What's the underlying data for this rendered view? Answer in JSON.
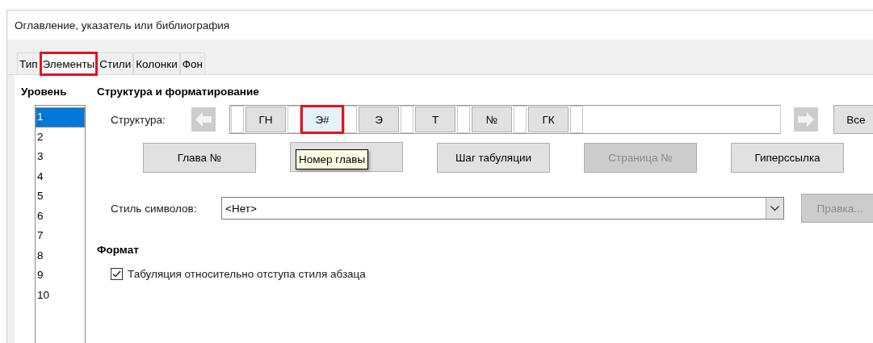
{
  "window": {
    "title": "Оглавление, указатель или библиография"
  },
  "tabs": [
    {
      "label": "Тип",
      "selected": false,
      "highlighted": false
    },
    {
      "label": "Элементы",
      "selected": true,
      "highlighted": true
    },
    {
      "label": "Стили",
      "selected": false,
      "highlighted": false
    },
    {
      "label": "Колонки",
      "selected": false,
      "highlighted": false
    },
    {
      "label": "Фон",
      "selected": false,
      "highlighted": false
    }
  ],
  "levels": {
    "heading": "Уровень",
    "items": [
      {
        "label": "1",
        "selected": true
      },
      {
        "label": "2",
        "selected": false
      },
      {
        "label": "3",
        "selected": false
      },
      {
        "label": "4",
        "selected": false
      },
      {
        "label": "5",
        "selected": false
      },
      {
        "label": "6",
        "selected": false
      },
      {
        "label": "7",
        "selected": false
      },
      {
        "label": "8",
        "selected": false
      },
      {
        "label": "9",
        "selected": false
      },
      {
        "label": "10",
        "selected": false
      }
    ]
  },
  "structure_section": {
    "heading": "Структура и форматирование",
    "structure_label": "Структура:",
    "tokens": [
      {
        "label": "ГН",
        "selected": false,
        "highlighted": false
      },
      {
        "label": "Э#",
        "selected": true,
        "highlighted": true
      },
      {
        "label": "Э",
        "selected": false,
        "highlighted": false
      },
      {
        "label": "Т",
        "selected": false,
        "highlighted": false
      },
      {
        "label": "№",
        "selected": false,
        "highlighted": false
      },
      {
        "label": "ГК",
        "selected": false,
        "highlighted": false
      }
    ],
    "all_button": "Все",
    "buttons": [
      {
        "label": "Глава №",
        "disabled": false
      },
      {
        "disabled": false
      },
      {
        "label": "Шаг табуляции",
        "disabled": false
      },
      {
        "label": "Страница №",
        "disabled": true
      },
      {
        "label": "Гиперссылка",
        "disabled": false
      }
    ],
    "tooltip": "Номер главы",
    "char_style_label": "Стиль символов:",
    "char_style_value": "<Нет>",
    "edit_button": {
      "label": "Правка...",
      "disabled": true
    }
  },
  "format_section": {
    "heading": "Формат",
    "checkbox": {
      "label": "Табуляция относительно отступа стиля абзаца",
      "checked": true
    }
  }
}
